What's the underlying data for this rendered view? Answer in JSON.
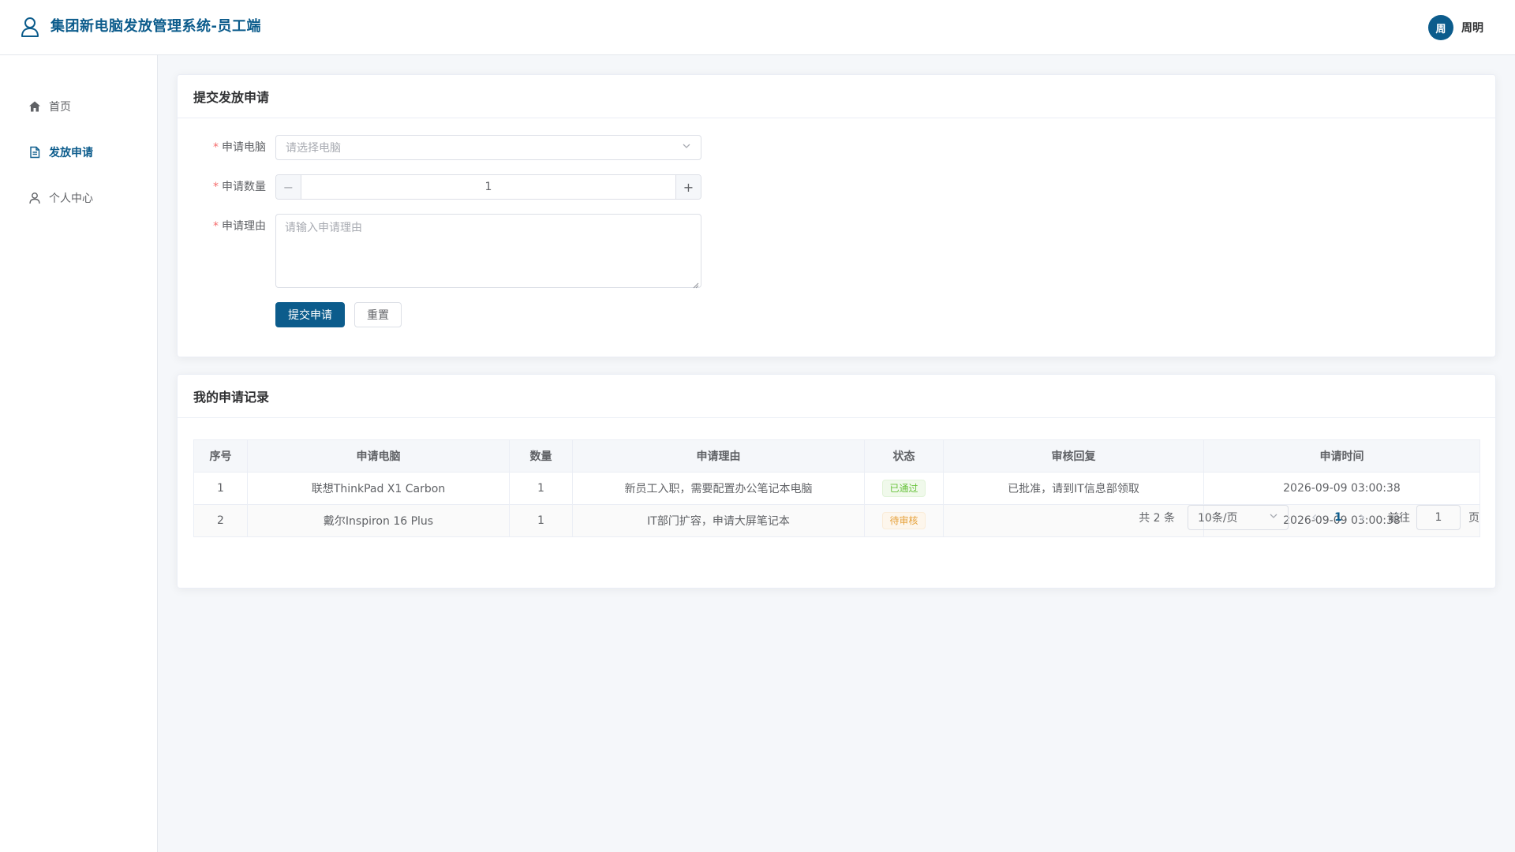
{
  "header": {
    "title": "集团新电脑发放管理系统-员工端",
    "user": {
      "avatar_char": "周",
      "name": "周明"
    }
  },
  "sidebar": {
    "items": [
      {
        "label": "首页",
        "icon": "home-icon",
        "active": false
      },
      {
        "label": "发放申请",
        "icon": "document-icon",
        "active": true
      },
      {
        "label": "个人中心",
        "icon": "user-icon",
        "active": false
      }
    ]
  },
  "form_card": {
    "title": "提交发放申请",
    "computer": {
      "label": "申请电脑",
      "placeholder": "请选择电脑"
    },
    "quantity": {
      "label": "申请数量",
      "value": "1",
      "minus": "−",
      "plus": "+"
    },
    "reason": {
      "label": "申请理由",
      "placeholder": "请输入申请理由"
    },
    "submit_label": "提交申请",
    "reset_label": "重置"
  },
  "records_card": {
    "title": "我的申请记录",
    "columns": [
      "序号",
      "申请电脑",
      "数量",
      "申请理由",
      "状态",
      "审核回复",
      "申请时间"
    ],
    "rows": [
      {
        "index": "1",
        "computer": "联想ThinkPad X1 Carbon",
        "qty": "1",
        "reason": "新员工入职，需要配置办公笔记本电脑",
        "status": "已通过",
        "status_type": "success",
        "reply": "已批准，请到IT信息部领取",
        "time": "2026-09-09 03:00:38"
      },
      {
        "index": "2",
        "computer": "戴尔Inspiron 16 Plus",
        "qty": "1",
        "reason": "IT部门扩容，申请大屏笔记本",
        "status": "待审核",
        "status_type": "warning",
        "reply": "",
        "time": "2026-09-09 03:00:38"
      }
    ],
    "pagination": {
      "total_text": "共 2 条",
      "page_size": "10条/页",
      "current_page": "1",
      "goto_label": "前往",
      "goto_value": "1",
      "goto_suffix": "页"
    }
  },
  "colors": {
    "primary": "#0c5c8c",
    "success": "#67c23a",
    "warning": "#e6a23c",
    "required": "#f56c6c"
  }
}
